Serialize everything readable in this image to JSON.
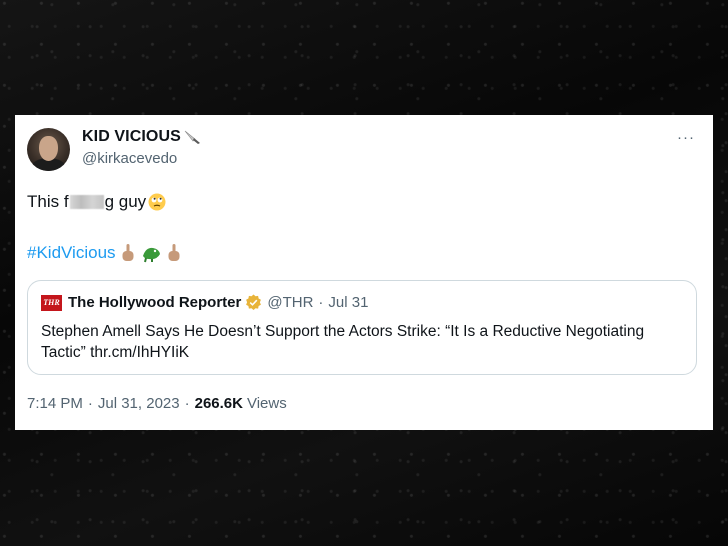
{
  "tweet": {
    "display_name": "KID VICIOUS",
    "handle": "@kirkacevedo",
    "more": "···",
    "text_before": "This f",
    "text_after": "g guy",
    "hashtag": "#KidVicious",
    "time": "7:14 PM",
    "date": "Jul 31, 2023",
    "views_count": "266.6K",
    "views_label": "Views"
  },
  "quote": {
    "logo_text": "THR",
    "name": "The Hollywood Reporter",
    "handle": "@THR",
    "separator": "·",
    "date": "Jul 31",
    "text": "Stephen Amell Says He Doesn’t Support the Actors Strike: “It Is a Reductive Negotiating Tactic” thr.cm/IhHYIiK"
  },
  "colors": {
    "link": "#1d9bf0",
    "secondary_text": "#536471",
    "primary_text": "#0f1419",
    "verified_gold": "#e8b43a",
    "thr_red": "#c4161c"
  },
  "icons": [
    "knife-icon",
    "more-icon",
    "eye-roll-emoji-icon",
    "middle-finger-icon",
    "crocodile-icon",
    "verified-badge-icon"
  ]
}
